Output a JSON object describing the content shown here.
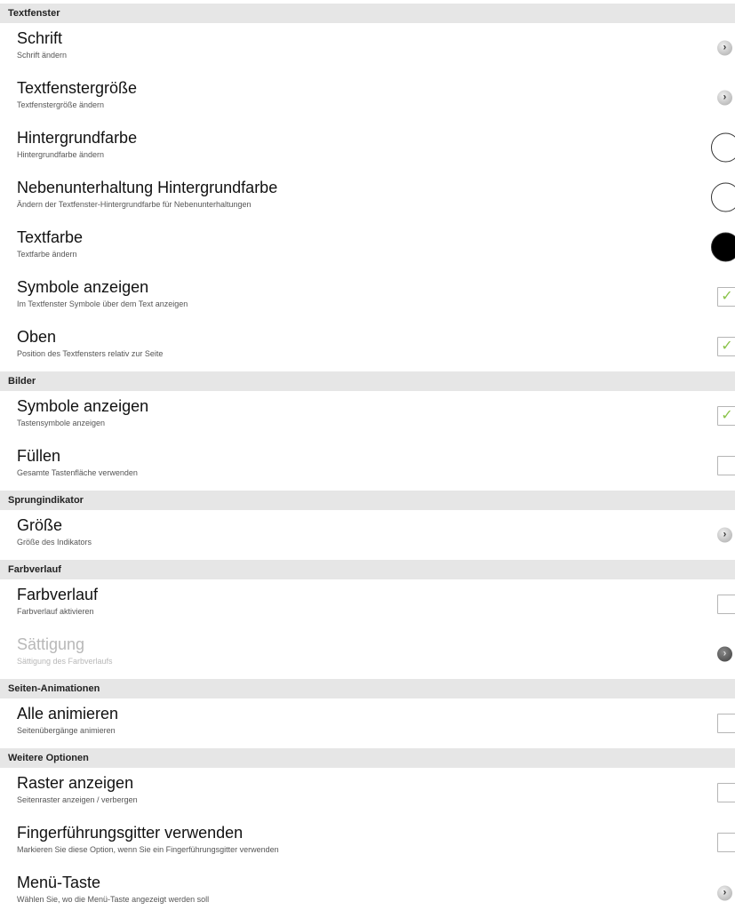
{
  "sections": [
    {
      "header": "Textfenster",
      "items": [
        {
          "title": "Schrift",
          "subtitle": "Schrift ändern",
          "widget": "chevron"
        },
        {
          "title": "Textfenstergröße",
          "subtitle": "Textfenstergröße ändern",
          "widget": "chevron"
        },
        {
          "title": "Hintergrundfarbe",
          "subtitle": "Hintergrundfarbe ändern",
          "widget": "color",
          "color": "#ffffff"
        },
        {
          "title": "Nebenunterhaltung Hintergrundfarbe",
          "subtitle": "Ändern der Textfenster-Hintergrundfarbe für Nebenunterhaltungen",
          "widget": "color",
          "color": "#ffffff"
        },
        {
          "title": "Textfarbe",
          "subtitle": "Textfarbe ändern",
          "widget": "color",
          "color": "#000000"
        },
        {
          "title": "Symbole anzeigen",
          "subtitle": "Im Textfenster Symbole über dem Text anzeigen",
          "widget": "checkbox",
          "checked": true
        },
        {
          "title": "Oben",
          "subtitle": "Position des Textfensters relativ zur Seite",
          "widget": "checkbox",
          "checked": true
        }
      ]
    },
    {
      "header": "Bilder",
      "items": [
        {
          "title": "Symbole anzeigen",
          "subtitle": "Tastensymbole anzeigen",
          "widget": "checkbox",
          "checked": true
        },
        {
          "title": "Füllen",
          "subtitle": "Gesamte Tastenfläche verwenden",
          "widget": "checkbox",
          "checked": false
        }
      ]
    },
    {
      "header": "Sprungindikator",
      "items": [
        {
          "title": "Größe",
          "subtitle": "Größe des Indikators",
          "widget": "chevron"
        }
      ]
    },
    {
      "header": "Farbverlauf",
      "items": [
        {
          "title": "Farbverlauf",
          "subtitle": "Farbverlauf aktivieren",
          "widget": "checkbox",
          "checked": false
        },
        {
          "title": "Sättigung",
          "subtitle": "Sättigung des Farbverlaufs",
          "widget": "chevron",
          "disabled": true
        }
      ]
    },
    {
      "header": "Seiten-Animationen",
      "items": [
        {
          "title": "Alle animieren",
          "subtitle": "Seitenübergänge animieren",
          "widget": "checkbox",
          "checked": false
        }
      ]
    },
    {
      "header": "Weitere Optionen",
      "items": [
        {
          "title": "Raster anzeigen",
          "subtitle": "Seitenraster anzeigen / verbergen",
          "widget": "checkbox",
          "checked": false
        },
        {
          "title": "Fingerführungsgitter verwenden",
          "subtitle": "Markieren Sie diese Option, wenn Sie ein Fingerführungsgitter verwenden",
          "widget": "checkbox",
          "checked": false
        },
        {
          "title": "Menü-Taste",
          "subtitle": "Wählen Sie, wo die Menü-Taste angezeigt werden soll",
          "widget": "chevron"
        }
      ]
    }
  ],
  "icons": {
    "chevron": "chevron-right-icon",
    "checkmark": "checkmark-icon"
  },
  "colors": {
    "header_bg": "#e6e6e6",
    "check_green": "#8bc34a",
    "disabled_text": "#b8b8b8"
  }
}
